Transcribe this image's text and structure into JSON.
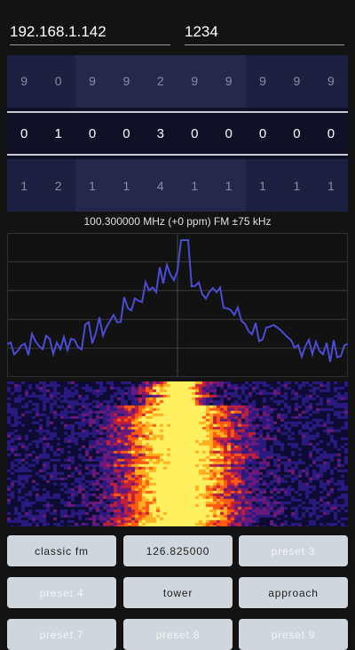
{
  "connection": {
    "host": "192.168.1.142",
    "port": "1234"
  },
  "tuner": {
    "prev_digits": [
      "9",
      "0",
      "9",
      "9",
      "2",
      "9",
      "9",
      "9",
      "9",
      "9"
    ],
    "current_digits": [
      "0",
      "1",
      "0",
      "0",
      "3",
      "0",
      "0",
      "0",
      "0",
      "0"
    ],
    "next_digits": [
      "1",
      "2",
      "1",
      "1",
      "4",
      "1",
      "1",
      "1",
      "1",
      "1"
    ]
  },
  "status": {
    "frequency_text": "100.300000 MHz (+0 ppm) FM ±75 kHz"
  },
  "spectrum": {
    "line_color": "#4b4bd6",
    "grid_color": "#3a3a3a"
  },
  "waterfall": {
    "palette": [
      "#0d0b33",
      "#2a1a80",
      "#6a1a7a",
      "#c0203a",
      "#ff5a10",
      "#ffb020",
      "#fff060"
    ]
  },
  "presets": [
    {
      "label": "classic fm",
      "dim": false
    },
    {
      "label": "126.825000",
      "dim": false
    },
    {
      "label": "preset 3",
      "dim": true
    },
    {
      "label": "preset 4",
      "dim": true
    },
    {
      "label": "tower",
      "dim": false
    },
    {
      "label": "approach",
      "dim": false
    },
    {
      "label": "preset 7",
      "dim": true
    },
    {
      "label": "preset 8",
      "dim": true
    },
    {
      "label": "preset 9",
      "dim": true
    }
  ],
  "colors": {
    "background": "#131313",
    "button_bg": "#cfd7dd"
  }
}
